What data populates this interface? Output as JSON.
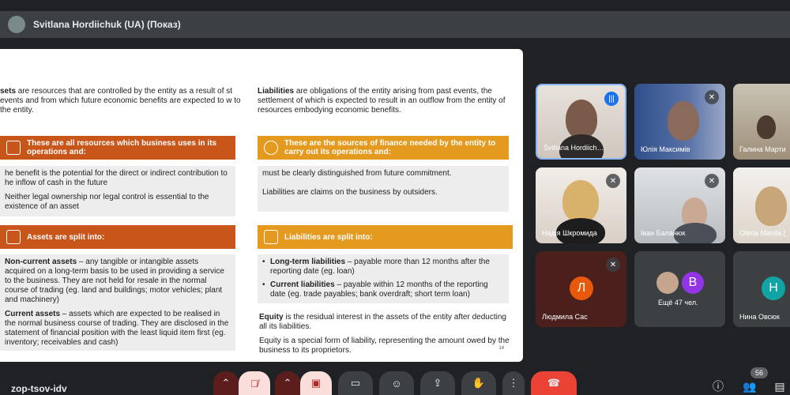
{
  "presenter": {
    "title": "Svitlana Hordiichuk (UA) (Показ)"
  },
  "slide": {
    "assets_term": "sets",
    "assets_def": " are resources that are controlled by the entity as a result of st events and from which future economic benefits are expected to w to the entity.",
    "liab_term": "Liabilities",
    "liab_def": " are obligations of the entity arising from past events, the settlement of which is expected to result in an outflow from the entity of resources embodying economic benefits.",
    "band1": "These are all resources which business uses in its operations and:",
    "band1_items": [
      "he benefit is the potential for the direct or indirect contribution to he inflow of cash in the future",
      "Neither legal ownership nor legal control is essential to the existence of an asset"
    ],
    "band2": "These are the sources of finance needed by the entity to carry out its operations and:",
    "band2_items": [
      "must be clearly distinguished from future commitment.",
      "Liabilities are claims on the business by outsiders."
    ],
    "band3": "Assets are split into:",
    "assets_split": [
      {
        "term": "Non-current assets",
        "text": " – any tangible or intangible assets acquired on a long-term basis to be used in providing a service to the business. They are not held for resale in the normal course of trading (eg. land and buildings; motor vehicles; plant and machinery)"
      },
      {
        "term": "Current assets",
        "text": " – assets which are expected to be realised in the normal business course of trading. They are disclosed in the statement of financial position with the least liquid item first (eg. inventory; receivables and cash)"
      }
    ],
    "band4": "Liabilities are split into:",
    "liab_split": [
      {
        "term": "Long-term liabilities",
        "text": " – payable more than 12 months after the reporting date (eg. loan)"
      },
      {
        "term": "Current liabilities",
        "text": " – payable within 12 months of the reporting date (eg. trade payables; bank overdraft; short term loan)"
      }
    ],
    "equity_term": "Equity",
    "equity_def": " is the residual interest in the assets of the entity after deducting all its liabilities.",
    "equity_note": "Equity is a special form of liability, representing the amount owed by the business to its proprietors.",
    "page_number": "14"
  },
  "participants": [
    {
      "name": "Svitlana Hordiich…"
    },
    {
      "name": "Юлія Максимів"
    },
    {
      "name": "Галина Марти"
    },
    {
      "name": "Надія Шкромида"
    },
    {
      "name": "Іван Баланюк"
    },
    {
      "name": "Olena Manila ("
    },
    {
      "name": "Людмила Сас",
      "initial": "Л"
    },
    {
      "name": "Ещё 47 чел.",
      "initial": "В"
    },
    {
      "name": "Нина Овсюк",
      "initial": "Н"
    }
  ],
  "bottom": {
    "meeting_code": "zop-tsov-idv",
    "participant_count": "56"
  },
  "colors": {
    "accent_orange": "#c8561a",
    "accent_amber": "#e39a1f",
    "end_call": "#ea4335"
  }
}
